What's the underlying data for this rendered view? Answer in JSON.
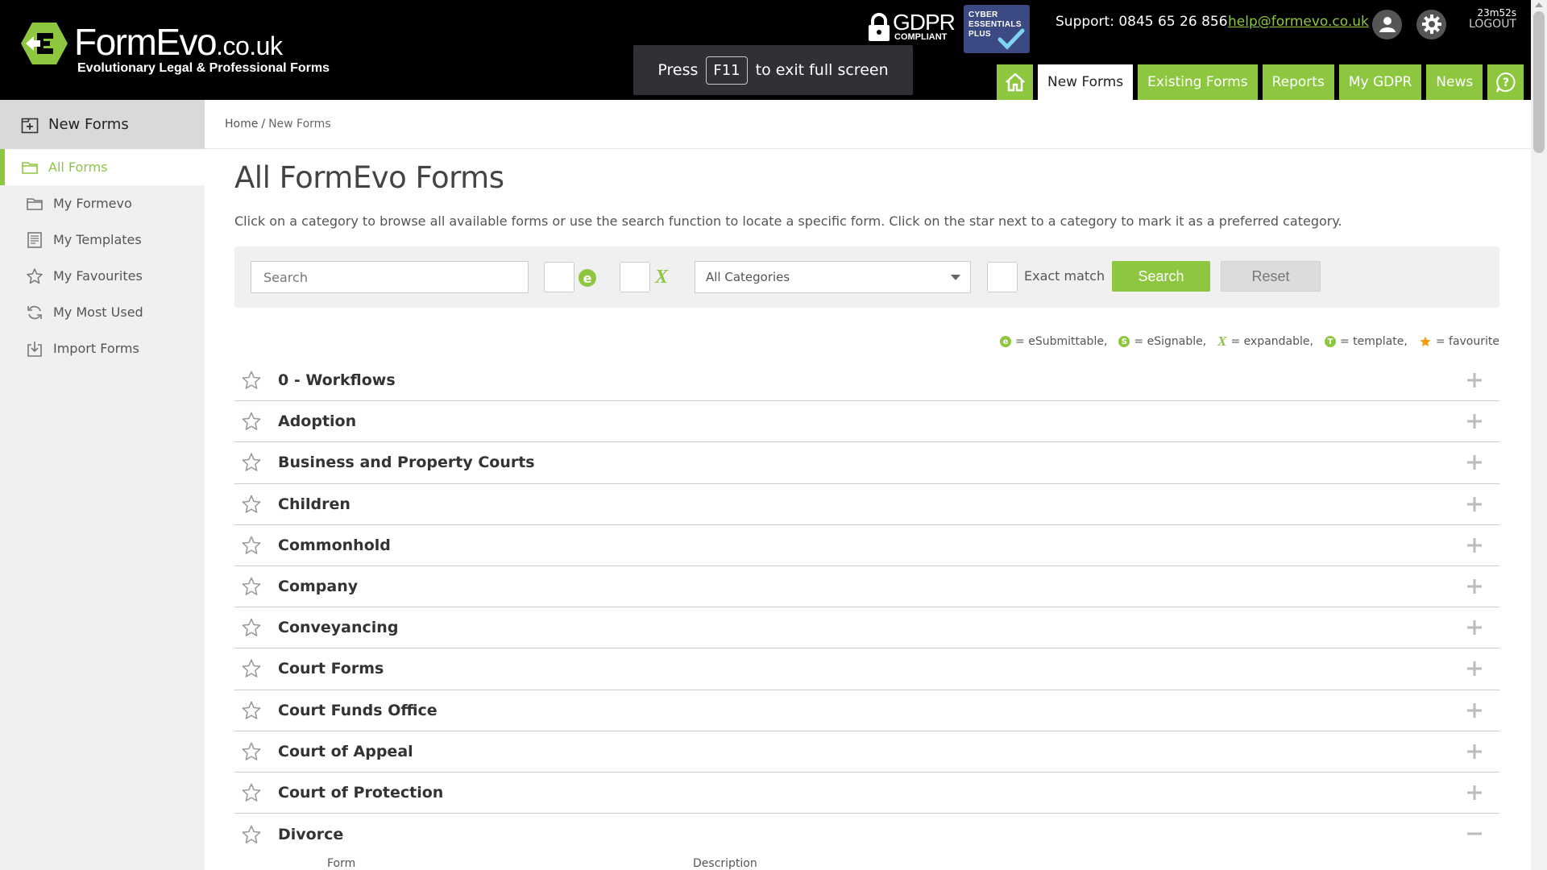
{
  "brand": {
    "name_main": "FormEvo",
    "name_tld": ".co.uk",
    "tagline": "Evolutionary Legal & Professional Forms",
    "accent_color": "#8dc63f"
  },
  "badges": {
    "gdpr_title": "GDPR",
    "gdpr_sub": "COMPLIANT",
    "cyber_line1": "CYBER",
    "cyber_line2": "ESSENTIALS",
    "cyber_line3": "PLUS"
  },
  "header": {
    "support": "Support: 0845 65 26 856",
    "email": "help@formevo.co.uk",
    "timer": "23m52s",
    "logout": "LOGOUT"
  },
  "fullscreen_notice": {
    "press": "Press",
    "key": "F11",
    "rest": "to exit full screen"
  },
  "nav": {
    "home_icon": "home-icon",
    "items": [
      "New Forms",
      "Existing Forms",
      "Reports",
      "My GDPR",
      "News"
    ],
    "active": "New Forms",
    "help_icon": "help-chat-icon"
  },
  "sidebar": {
    "heading": "New Forms",
    "items": [
      {
        "label": "All Forms",
        "icon": "folder-icon",
        "active": true
      },
      {
        "label": "My Formevo",
        "icon": "folder-icon",
        "active": false
      },
      {
        "label": "My Templates",
        "icon": "template-icon",
        "active": false
      },
      {
        "label": "My Favourites",
        "icon": "star-icon",
        "active": false
      },
      {
        "label": "My Most Used",
        "icon": "refresh-icon",
        "active": false
      },
      {
        "label": "Import Forms",
        "icon": "import-icon",
        "active": false
      }
    ]
  },
  "breadcrumb": {
    "home": "Home",
    "separator": "/",
    "current": "New Forms"
  },
  "main": {
    "title": "All FormEvo Forms",
    "intro": "Click on a category to browse all available forms or use the search function to locate a specific form. Click on the star next to a category to mark it as a preferred category."
  },
  "search": {
    "placeholder": "Search",
    "value": "",
    "category_selected": "All Categories",
    "exact_match_label": "Exact match",
    "search_button": "Search",
    "reset_button": "Reset"
  },
  "legend": {
    "esubmittable": "= eSubmittable,",
    "esignable": "= eSignable,",
    "expandable": "= expandable,",
    "template": "= template,",
    "favourite": "= favourite"
  },
  "categories": [
    {
      "name": "0 - Workflows",
      "expanded": false
    },
    {
      "name": "Adoption",
      "expanded": false
    },
    {
      "name": "Business and Property Courts",
      "expanded": false
    },
    {
      "name": "Children",
      "expanded": false
    },
    {
      "name": "Commonhold",
      "expanded": false
    },
    {
      "name": "Company",
      "expanded": false
    },
    {
      "name": "Conveyancing",
      "expanded": false
    },
    {
      "name": "Court Forms",
      "expanded": false
    },
    {
      "name": "Court Funds Office",
      "expanded": false
    },
    {
      "name": "Court of Appeal",
      "expanded": false
    },
    {
      "name": "Court of Protection",
      "expanded": false
    },
    {
      "name": "Divorce",
      "expanded": true
    }
  ],
  "form_table": {
    "col_form": "Form",
    "col_description": "Description"
  }
}
